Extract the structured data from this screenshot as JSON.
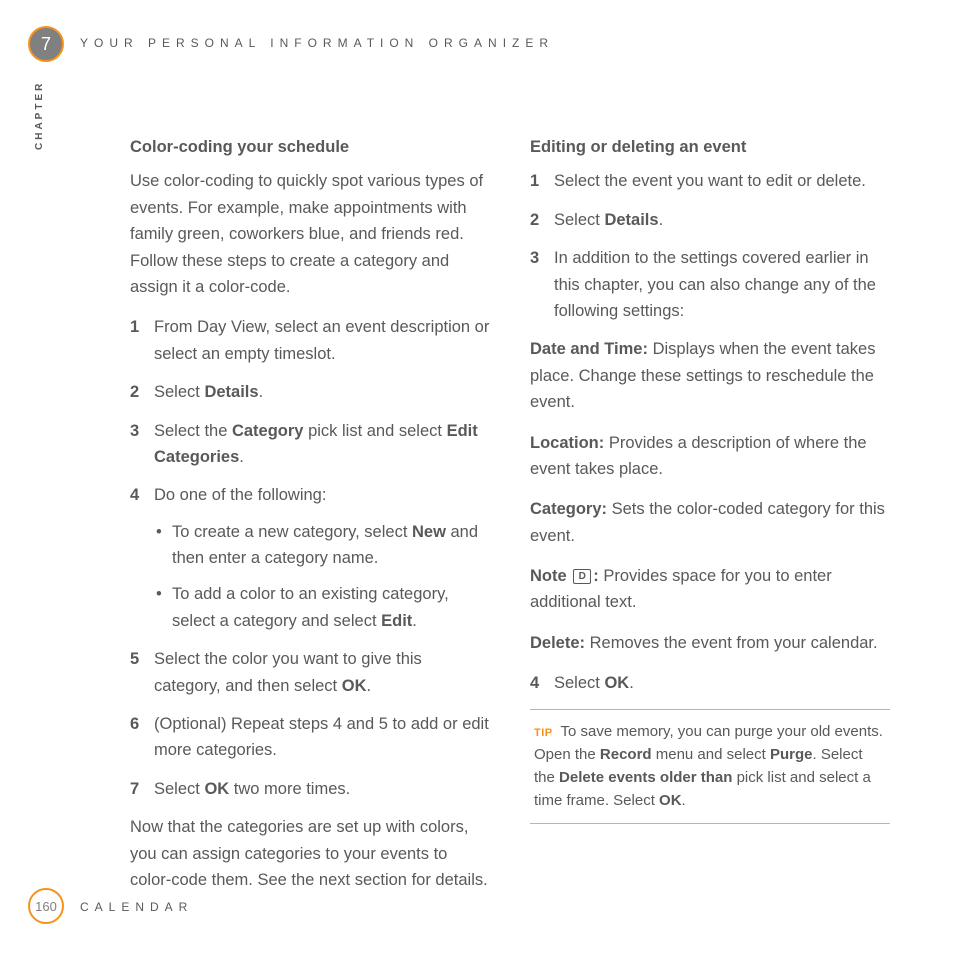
{
  "header": {
    "chapter_number": "7",
    "chapter_title": "YOUR PERSONAL INFORMATION ORGANIZER",
    "side_label": "CHAPTER"
  },
  "left": {
    "heading": "Color-coding your schedule",
    "intro": "Use color-coding to quickly spot various types of events. For example, make appointments with family green, coworkers blue, and friends red. Follow these steps to create a category and assign it a color-code.",
    "steps": {
      "s1": "From Day View, select an event description or select an empty timeslot.",
      "s2a": "Select ",
      "s2b": "Details",
      "s2c": ".",
      "s3a": "Select the ",
      "s3b": "Category",
      "s3c": " pick list and select ",
      "s3d": "Edit Categories",
      "s3e": ".",
      "s4": "Do one of the following:",
      "s4_b1a": "To create a new category, select ",
      "s4_b1b": "New",
      "s4_b1c": " and then enter a category name.",
      "s4_b2a": "To add a color to an existing category, select a category and select ",
      "s4_b2b": "Edit",
      "s4_b2c": ".",
      "s5a": "Select the color you want to give this category, and then select ",
      "s5b": "OK",
      "s5c": ".",
      "s6": "(Optional)  Repeat steps 4 and 5 to add or edit more categories.",
      "s7a": "Select ",
      "s7b": "OK",
      "s7c": " two more times."
    },
    "outro": "Now that the categories are set up with colors, you can assign categories to your events to color-code them. See the next section for details."
  },
  "right": {
    "heading": "Editing or deleting an event",
    "steps": {
      "s1": "Select the event you want to edit or delete.",
      "s2a": "Select ",
      "s2b": "Details",
      "s2c": ".",
      "s3": "In addition to the settings covered earlier in this chapter, you can also change any of the following settings:",
      "d1_label": "Date and Time:",
      "d1_text": " Displays when the event takes place. Change these settings to reschedule the event.",
      "d2_label": "Location:",
      "d2_text": " Provides a description of where the event takes place.",
      "d3_label": "Category:",
      "d3_text": " Sets the color-coded category for this event.",
      "d4_label": "Note ",
      "d4_icon": "D",
      "d4_colon": ":",
      "d4_text": " Provides space for you to enter additional text.",
      "d5_label": "Delete:",
      "d5_text": " Removes the event from your calendar.",
      "s4a": "Select ",
      "s4b": "OK",
      "s4c": "."
    },
    "tip": {
      "label": "TIP",
      "t1": " To save memory, you can purge your old events. Open the ",
      "t2": "Record",
      "t3": " menu and select ",
      "t4": "Purge",
      "t5": ". Select the ",
      "t6": "Delete events older than",
      "t7": " pick list and select a time frame. Select ",
      "t8": "OK",
      "t9": "."
    }
  },
  "footer": {
    "page": "160",
    "section": "CALENDAR"
  }
}
